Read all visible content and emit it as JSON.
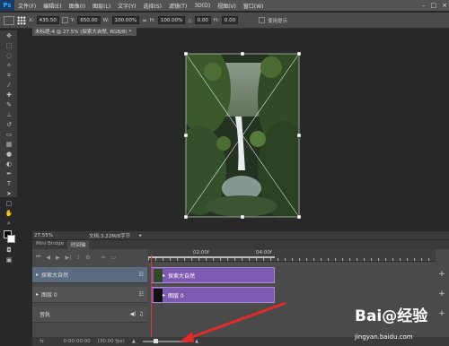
{
  "menubar": {
    "app_icon": "Ps",
    "items": [
      "文件(F)",
      "编辑(E)",
      "图像(I)",
      "图层(L)",
      "文字(Y)",
      "选择(S)",
      "滤镜(T)",
      "3D(D)",
      "视图(V)",
      "窗口(W)"
    ],
    "window_controls": [
      "–",
      "□",
      "×"
    ]
  },
  "optbar": {
    "x_label": "X:",
    "x_value": "435.50",
    "y_label": "Y:",
    "y_value": "650.00",
    "w_label": "W:",
    "w_value": "100.00%",
    "h_label": "H:",
    "h_value": "100.00%",
    "angle_label": "△",
    "angle_value": "0.00",
    "interp_label": "H:",
    "interp_value": "0.00",
    "last_button": "使用提示"
  },
  "document": {
    "tab_title": "未标题-4 @ 27.5% (探索大自然, RGB/8) *",
    "zoom": "27.55%",
    "doc_info": "文档:3.22M/8字节"
  },
  "panel_tabs": [
    "Mini Bridge",
    "时间轴"
  ],
  "timeline": {
    "ruler_ticks": [
      "02:00f",
      "04:00f"
    ],
    "tracks": [
      {
        "label": "探索大自然",
        "clip": "探索大自然"
      },
      {
        "label": "图层 0",
        "clip": "图层 0"
      },
      {
        "label": "音轨"
      }
    ],
    "bottom": {
      "time": "0:00:00:00",
      "fps": "(30.00 fps)"
    }
  },
  "watermark": {
    "brand": "Bai@经验",
    "url": "jingyan.baidu.com"
  }
}
